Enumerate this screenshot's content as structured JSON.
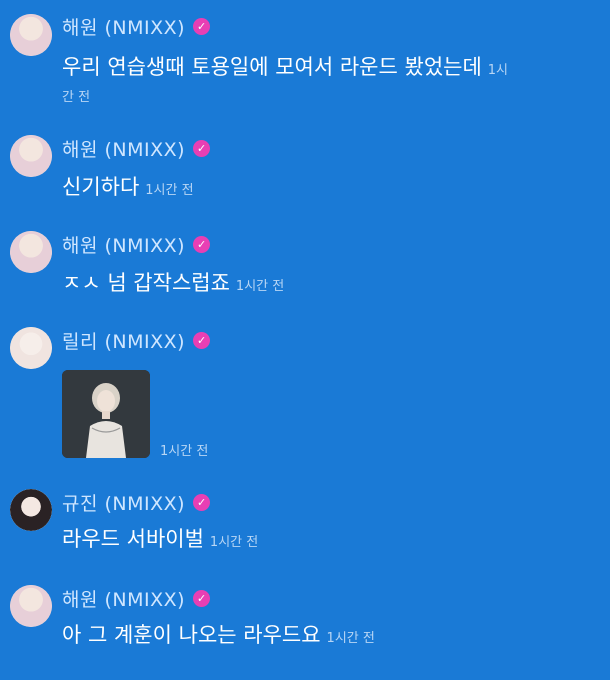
{
  "messages": [
    {
      "author": "해원 (NMIXX)",
      "text_line1": "우리 연습생때 토용일에 모여서 라운드 봤었는데",
      "time_part1": "1시",
      "time_part2": "간 전",
      "avatar": "haewon-avatar"
    },
    {
      "author": "해원 (NMIXX)",
      "text": "신기하다",
      "time": "1시간 전",
      "avatar": "haewon-avatar"
    },
    {
      "author": "해원 (NMIXX)",
      "text": "ㅈㅅ 넘 갑작스럽죠",
      "time": "1시간 전",
      "avatar": "haewon-avatar"
    },
    {
      "author": "릴리 (NMIXX)",
      "image": "photo-attachment",
      "time": "1시간 전",
      "avatar": "lily-avatar"
    },
    {
      "author": "규진 (NMIXX)",
      "text": "라우드 서바이벌",
      "time": "1시간 전",
      "avatar": "kyujin-avatar"
    },
    {
      "author": "해원 (NMIXX)",
      "text": "아 그 계훈이 나오는 라우드요",
      "time": "1시간 전",
      "avatar": "haewon-avatar"
    }
  ],
  "verified_icon": "verified-check-icon",
  "colors": {
    "background": "#1a7ad6",
    "name": "#cfe6ff",
    "badge": "#e83fb4",
    "text": "#ffffff",
    "time": "#b8d6f5"
  }
}
